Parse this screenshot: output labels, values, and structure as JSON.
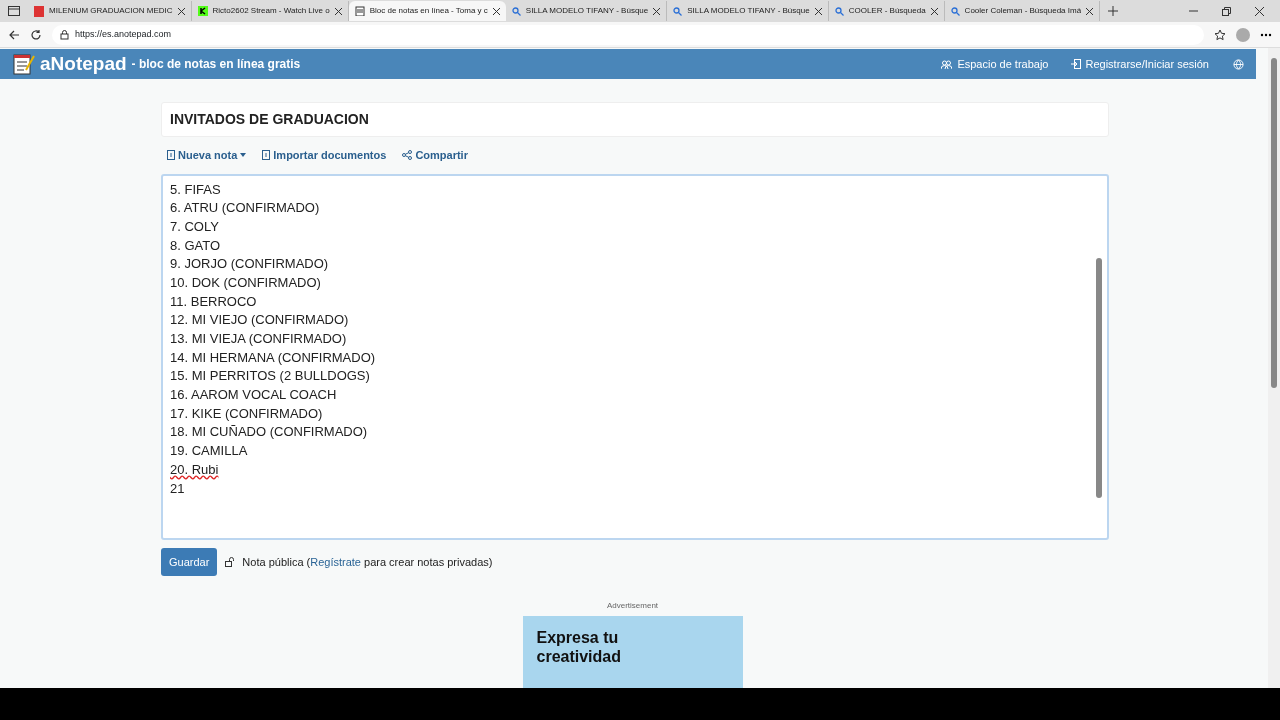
{
  "browser": {
    "tabs": [
      {
        "title": "MILENIUM GRADUACION MEDIC",
        "kind": "pdf",
        "selected": false
      },
      {
        "title": "Ricto2602 Stream - Watch Live o",
        "kind": "stream",
        "selected": false
      },
      {
        "title": "Bloc de notas en línea - Toma y c",
        "kind": "notepad",
        "selected": true
      },
      {
        "title": "SILLA MODELO TIFANY - Búsque",
        "kind": "search",
        "selected": false
      },
      {
        "title": "SILLA MODELO TIFANY - Búsque",
        "kind": "search",
        "selected": false
      },
      {
        "title": "COOLER - Búsqueda",
        "kind": "search",
        "selected": false
      },
      {
        "title": "Cooler Coleman - Búsqueda Imá",
        "kind": "search",
        "selected": false
      }
    ],
    "url": "https://es.anotepad.com"
  },
  "site_header": {
    "brand": "aNotepad",
    "tagline": "- bloc de notas en línea gratis",
    "links": [
      "Espacio de trabajo",
      "Registrarse/Iniciar sesión"
    ]
  },
  "note": {
    "title": "INVITADOS DE GRADUACION",
    "toolbar": [
      "Nueva nota",
      "Importar documentos",
      "Compartir"
    ],
    "lines": [
      {
        "text": "5. FIFAS",
        "misspelled": false
      },
      {
        "text": "6. ATRU (CONFIRMADO)",
        "misspelled": false
      },
      {
        "text": "7. COLY",
        "misspelled": false
      },
      {
        "text": "8. GATO",
        "misspelled": false
      },
      {
        "text": "9. JORJO (CONFIRMADO)",
        "misspelled": false
      },
      {
        "text": "10. DOK (CONFIRMADO)",
        "misspelled": false
      },
      {
        "text": "11. BERROCO",
        "misspelled": false
      },
      {
        "text": "12. MI VIEJO (CONFIRMADO)",
        "misspelled": false
      },
      {
        "text": "13. MI VIEJA (CONFIRMADO)",
        "misspelled": false
      },
      {
        "text": "14. MI HERMANA (CONFIRMADO)",
        "misspelled": false
      },
      {
        "text": "15. MI PERRITOS (2 BULLDOGS)",
        "misspelled": false
      },
      {
        "text": "16. AAROM VOCAL COACH",
        "misspelled": false
      },
      {
        "text": "17. KIKE (CONFIRMADO)",
        "misspelled": false
      },
      {
        "text": "18. MI CUÑADO (CONFIRMADO)",
        "misspelled": false
      },
      {
        "text": "19. CAMILLA",
        "misspelled": false
      },
      {
        "text": "20. Rubi",
        "misspelled": true
      },
      {
        "text": "21",
        "misspelled": false
      }
    ],
    "save_button": "Guardar",
    "privacy": {
      "before": "Nota pública (",
      "link": "Regístrate",
      "after": " para crear notas privadas)"
    }
  },
  "ad": {
    "label": "Advertisement",
    "headline": "Expresa tu creatividad"
  }
}
